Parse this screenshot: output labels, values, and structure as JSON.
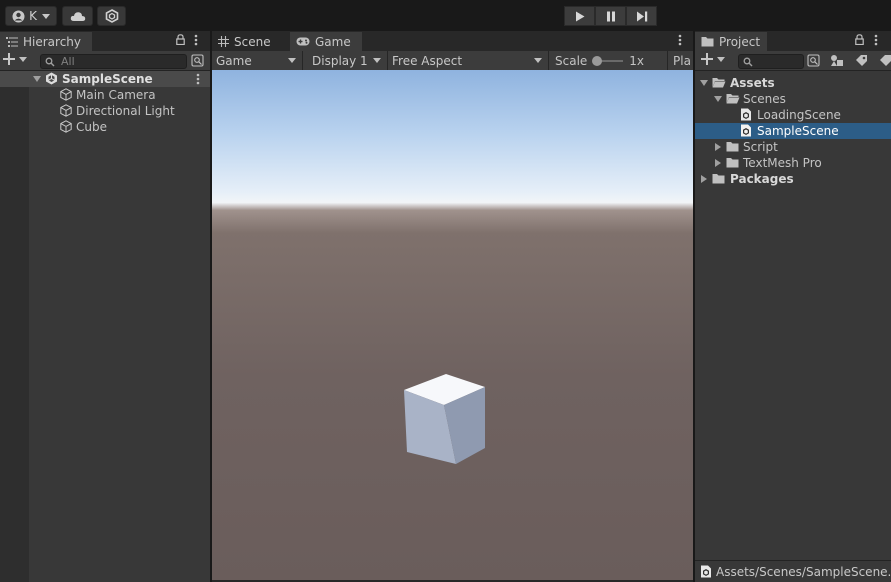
{
  "toolbar": {
    "account_initial": "K"
  },
  "hierarchy": {
    "tab_label": "Hierarchy",
    "search_placeholder": "All",
    "scene_name": "SampleScene",
    "items": [
      "Main Camera",
      "Directional Light",
      "Cube"
    ]
  },
  "center": {
    "tabs": [
      "Scene",
      "Game"
    ],
    "game_dropdown": "Game",
    "display_dropdown": "Display 1",
    "aspect_dropdown": "Free Aspect",
    "scale_label": "Scale",
    "scale_value": "1x",
    "play_label_clipped": "Pla"
  },
  "project": {
    "tab_label": "Project",
    "tree": {
      "assets": "Assets",
      "scenes": "Scenes",
      "loading_scene": "LoadingScene",
      "sample_scene": "SampleScene",
      "script": "Script",
      "textmesh": "TextMesh Pro",
      "packages": "Packages"
    },
    "status_path": "Assets/Scenes/SampleScene.u"
  },
  "colors": {
    "selection": "#2c5d87",
    "panel": "#383838",
    "tabbar": "#282828"
  }
}
